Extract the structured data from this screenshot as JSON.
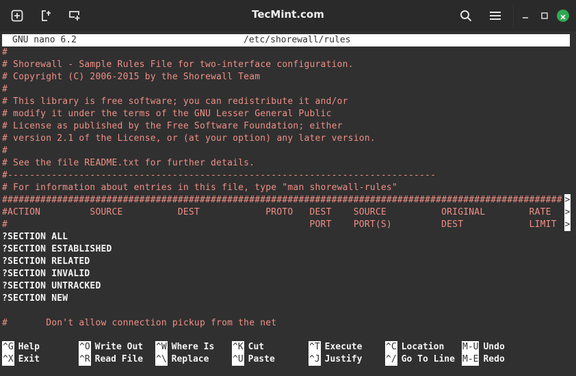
{
  "window": {
    "title": "TecMint.com",
    "colors": {
      "titlebar": "#2a2a2a",
      "terminal_bg": "#303030",
      "comment": "#ef8f86",
      "text": "#f4f4f4",
      "close": "#2fa84f"
    }
  },
  "titlebar_icons": {
    "new_tab": "new-tab-icon",
    "split": "split-icon",
    "new_window": "new-window-icon",
    "search": "search-icon",
    "menu": "hamburger-menu-icon",
    "minimize": "minimize-icon",
    "maximize": "maximize-icon",
    "close": "close-icon"
  },
  "nano": {
    "version": "GNU nano 6.2",
    "filename": "/etc/shorewall/rules"
  },
  "lines": [
    {
      "text": "#",
      "type": "comment"
    },
    {
      "text": "# Shorewall - Sample Rules File for two-interface configuration.",
      "type": "comment"
    },
    {
      "text": "# Copyright (C) 2006-2015 by the Shorewall Team",
      "type": "comment"
    },
    {
      "text": "#",
      "type": "comment"
    },
    {
      "text": "# This library is free software; you can redistribute it and/or",
      "type": "comment"
    },
    {
      "text": "# modify it under the terms of the GNU Lesser General Public",
      "type": "comment"
    },
    {
      "text": "# License as published by the Free Software Foundation; either",
      "type": "comment"
    },
    {
      "text": "# version 2.1 of the License, or (at your option) any later version.",
      "type": "comment"
    },
    {
      "text": "#",
      "type": "comment"
    },
    {
      "text": "# See the file README.txt for further details.",
      "type": "comment"
    },
    {
      "text": "#------------------------------------------------------------------------------",
      "type": "comment"
    },
    {
      "text": "# For information about entries in this file, type \"man shorewall-rules\"",
      "type": "comment"
    },
    {
      "text": "######################################################################################################",
      "type": "comment",
      "more": true
    },
    {
      "text": "#ACTION         SOURCE          DEST            PROTO   DEST    SOURCE          ORIGINAL        RATE",
      "type": "comment",
      "more": true
    },
    {
      "text": "#                                                       PORT    PORT(S)         DEST            LIMIT",
      "type": "comment",
      "more": true
    },
    {
      "text": "?SECTION ALL",
      "type": "plain"
    },
    {
      "text": "?SECTION ESTABLISHED",
      "type": "plain"
    },
    {
      "text": "?SECTION RELATED",
      "type": "plain"
    },
    {
      "text": "?SECTION INVALID",
      "type": "plain"
    },
    {
      "text": "?SECTION UNTRACKED",
      "type": "plain"
    },
    {
      "text": "?SECTION NEW",
      "type": "plain"
    },
    {
      "text": "",
      "type": "plain"
    },
    {
      "text": "#       Don't allow connection pickup from the net",
      "type": "comment"
    }
  ],
  "more_indicator": ">",
  "shortcuts": [
    {
      "key": "^G",
      "label": "Help"
    },
    {
      "key": "^O",
      "label": "Write Out"
    },
    {
      "key": "^W",
      "label": "Where Is"
    },
    {
      "key": "^K",
      "label": "Cut"
    },
    {
      "key": "^T",
      "label": "Execute"
    },
    {
      "key": "^C",
      "label": "Location"
    },
    {
      "key": "M-U",
      "label": "Undo"
    },
    {
      "key": "^X",
      "label": "Exit"
    },
    {
      "key": "^R",
      "label": "Read File"
    },
    {
      "key": "^\\",
      "label": "Replace"
    },
    {
      "key": "^U",
      "label": "Paste"
    },
    {
      "key": "^J",
      "label": "Justify"
    },
    {
      "key": "^/",
      "label": "Go To Line"
    },
    {
      "key": "M-E",
      "label": "Redo"
    }
  ]
}
